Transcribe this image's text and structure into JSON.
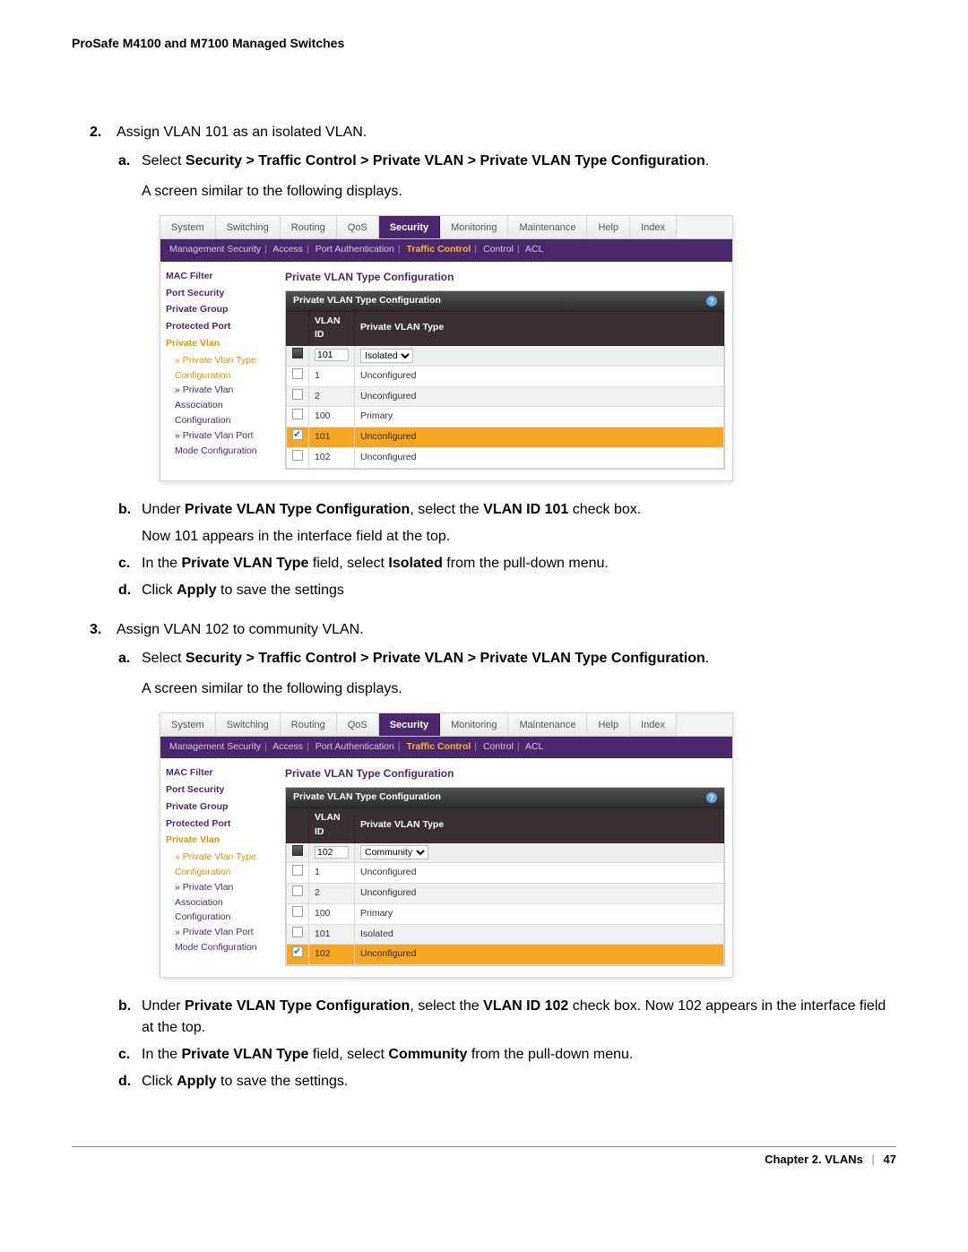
{
  "header": {
    "title": "ProSafe M4100 and M7100 Managed Switches"
  },
  "step2": {
    "num": "2.",
    "title": "Assign VLAN 101 as an isolated VLAN.",
    "a": {
      "letter": "a.",
      "prefix": "Select ",
      "path": "Security > Traffic Control > Private VLAN > Private VLAN Type Configuration",
      "dot": "."
    },
    "caption": "A screen similar to the following displays.",
    "b": {
      "letter": "b.",
      "t1": "Under ",
      "b1": "Private VLAN Type Configuration",
      "t2": ", select the ",
      "b2": "VLAN ID 101",
      "t3": " check box.",
      "follow": "Now 101 appears in the interface field at the top."
    },
    "c": {
      "letter": "c.",
      "t1": "In the ",
      "b1": "Private VLAN Type",
      "t2": " field, select ",
      "b2": "Isolated",
      "t3": " from the pull-down menu."
    },
    "d": {
      "letter": "d.",
      "t1": "Click ",
      "b1": "Apply",
      "t2": " to save the settings"
    }
  },
  "step3": {
    "num": "3.",
    "title": "Assign VLAN 102 to community VLAN.",
    "a": {
      "letter": "a.",
      "prefix": "Select ",
      "path": "Security > Traffic Control > Private VLAN > Private VLAN Type Configuration",
      "dot": "."
    },
    "caption": "A screen similar to the following displays.",
    "b": {
      "letter": "b.",
      "t1": "Under ",
      "b1": "Private VLAN Type Configuration",
      "t2": ", select the ",
      "b2": "VLAN ID 102",
      "t3": " check box. Now 102 appears in the interface field at the top."
    },
    "c": {
      "letter": "c.",
      "t1": "In the ",
      "b1": "Private VLAN Type",
      "t2": " field, select ",
      "b2": "Community",
      "t3": " from the pull-down menu."
    },
    "d": {
      "letter": "d.",
      "t1": "Click ",
      "b1": "Apply",
      "t2": " to save the settings."
    }
  },
  "ui": {
    "tabs": {
      "system": "System",
      "switching": "Switching",
      "routing": "Routing",
      "qos": "QoS",
      "security": "Security",
      "monitoring": "Monitoring",
      "maintenance": "Maintenance",
      "help": "Help",
      "index": "Index"
    },
    "subnav": {
      "i0": "Management Security",
      "i1": "Access",
      "i2": "Port Authentication",
      "i3": "Traffic Control",
      "i4": "Control",
      "i5": "ACL"
    },
    "sidebar": {
      "mac_filter": "MAC Filter",
      "port_security": "Port Security",
      "private_group": "Private Group",
      "protected_port": "Protected Port",
      "private_vlan": "Private Vlan",
      "type_conf": "Private Vlan Type Configuration",
      "assoc_conf": "Private Vlan Association Configuration",
      "port_mode": "Private Vlan Port Mode Configuration"
    },
    "content": {
      "title": "Private VLAN Type Configuration",
      "panel_header": "Private VLAN Type Configuration",
      "col_vlan_id": "VLAN ID",
      "col_type": "Private VLAN Type"
    }
  },
  "screenshot1": {
    "filter": {
      "id": "101",
      "type": "Isolated"
    },
    "rows": [
      {
        "id": "1",
        "type": "Unconfigured",
        "alt": false,
        "checked": false,
        "selected": false
      },
      {
        "id": "2",
        "type": "Unconfigured",
        "alt": true,
        "checked": false,
        "selected": false
      },
      {
        "id": "100",
        "type": "Primary",
        "alt": false,
        "checked": false,
        "selected": false
      },
      {
        "id": "101",
        "type": "Unconfigured",
        "alt": true,
        "checked": true,
        "selected": true
      },
      {
        "id": "102",
        "type": "Unconfigured",
        "alt": false,
        "checked": false,
        "selected": false
      }
    ]
  },
  "screenshot2": {
    "filter": {
      "id": "102",
      "type": "Community"
    },
    "rows": [
      {
        "id": "1",
        "type": "Unconfigured",
        "alt": false,
        "checked": false,
        "selected": false
      },
      {
        "id": "2",
        "type": "Unconfigured",
        "alt": true,
        "checked": false,
        "selected": false
      },
      {
        "id": "100",
        "type": "Primary",
        "alt": false,
        "checked": false,
        "selected": false
      },
      {
        "id": "101",
        "type": "Isolated",
        "alt": true,
        "checked": false,
        "selected": false
      },
      {
        "id": "102",
        "type": "Unconfigured",
        "alt": false,
        "checked": true,
        "selected": true
      }
    ]
  },
  "footer": {
    "chapter": "Chapter 2.  VLANs",
    "page": "47"
  }
}
